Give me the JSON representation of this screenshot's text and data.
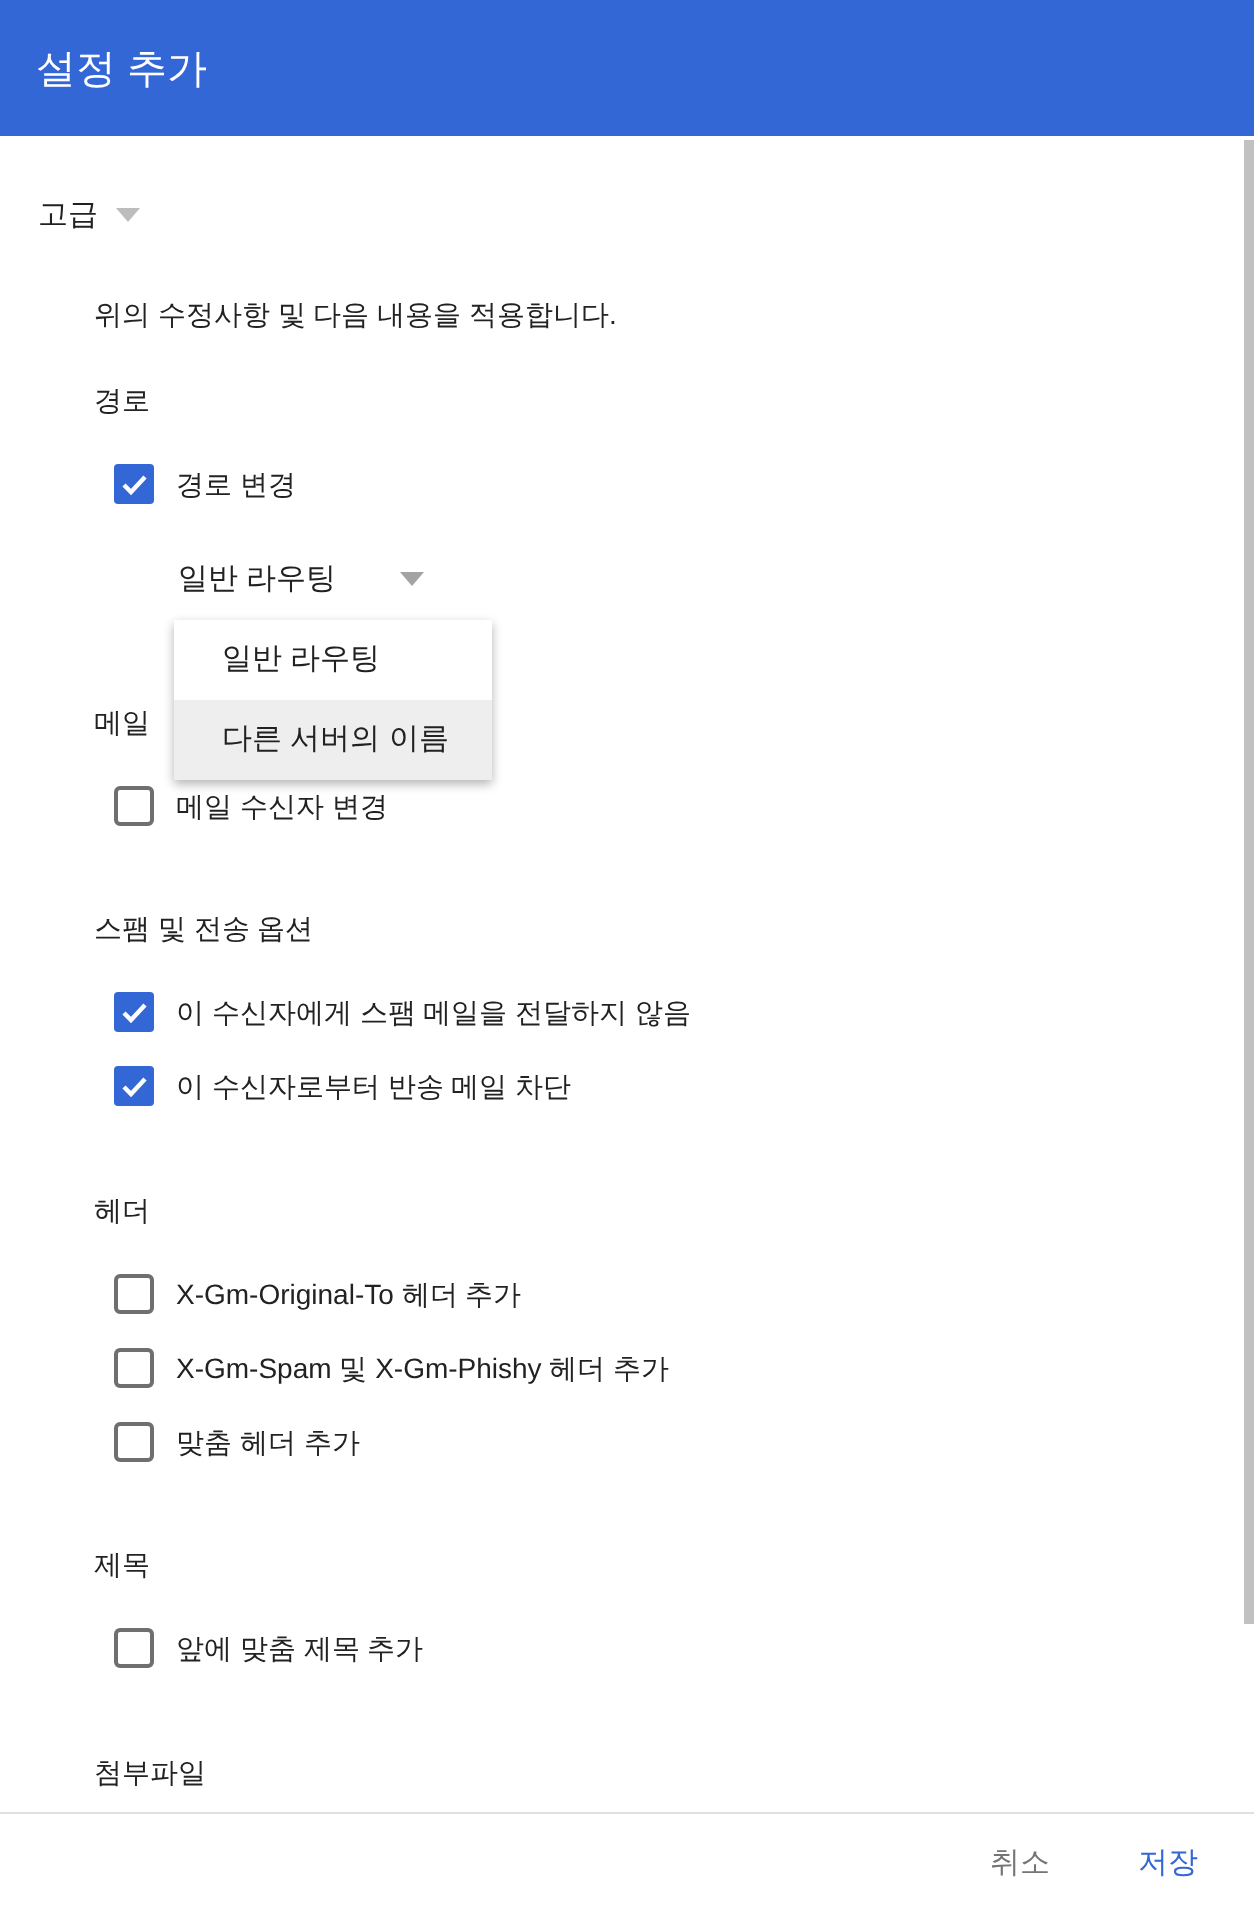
{
  "dialog": {
    "title": "설정 추가"
  },
  "advanced": {
    "label": "고급",
    "expanded": true
  },
  "intro": "위의 수정사항 및 다음 내용을 적용합니다.",
  "sections": [
    {
      "heading": "경로",
      "items": [
        {
          "kind": "checkbox",
          "label": "경로 변경",
          "checked": true
        },
        {
          "kind": "select",
          "value": "일반 라우팅",
          "open": true,
          "options": [
            {
              "label": "일반 라우팅",
              "highlighted": false
            },
            {
              "label": "다른 서버의 이름",
              "highlighted": true
            }
          ]
        }
      ]
    },
    {
      "heading": "메일",
      "items": [
        {
          "kind": "checkbox",
          "label": "메일 수신자 변경",
          "checked": false
        }
      ]
    },
    {
      "heading": "스팸 및 전송 옵션",
      "items": [
        {
          "kind": "checkbox",
          "label": "이 수신자에게 스팸 메일을 전달하지 않음",
          "checked": true
        },
        {
          "kind": "checkbox",
          "label": "이 수신자로부터 반송 메일 차단",
          "checked": true
        }
      ]
    },
    {
      "heading": "헤더",
      "items": [
        {
          "kind": "checkbox",
          "label": "X-Gm-Original-To 헤더 추가",
          "checked": false
        },
        {
          "kind": "checkbox",
          "label": "X-Gm-Spam 및 X-Gm-Phishy 헤더 추가",
          "checked": false
        },
        {
          "kind": "checkbox",
          "label": "맞춤 헤더 추가",
          "checked": false
        }
      ]
    },
    {
      "heading": "제목",
      "items": [
        {
          "kind": "checkbox",
          "label": "앞에 맞춤 제목 추가",
          "checked": false
        }
      ]
    },
    {
      "heading": "첨부파일"
    }
  ],
  "footer_buttons": [
    {
      "label": "취소",
      "kind": "secondary"
    },
    {
      "label": "저장",
      "kind": "primary"
    }
  ]
}
